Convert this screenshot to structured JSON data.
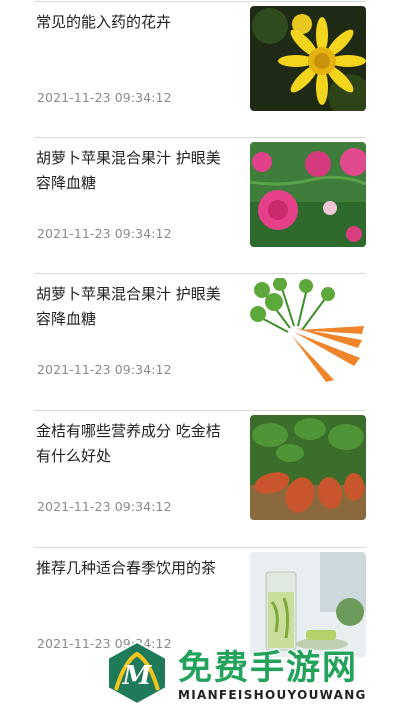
{
  "articles": [
    {
      "title": "常见的能入药的花卉",
      "time": "2021-11-23 09:34:12",
      "image": "yellow-chrysanthemum"
    },
    {
      "title": "胡萝卜苹果混合果汁 护眼美容降血糖",
      "time": "2021-11-23 09:34:12",
      "image": "pink-peonies"
    },
    {
      "title": "胡萝卜苹果混合果汁 护眼美容降血糖",
      "time": "2021-11-23 09:34:12",
      "image": "carrots"
    },
    {
      "title": "金桔有哪些营养成分 吃金桔有什么好处",
      "time": "2021-11-23 09:34:12",
      "image": "sweet-potatoes"
    },
    {
      "title": "推荐几种适合春季饮用的茶",
      "time": "2021-11-23 09:34:12",
      "image": "green-tea-glass"
    }
  ],
  "watermark": {
    "title": "免费手游网",
    "subtitle": "MIANFEISHOUYOUWANG",
    "logo_letter": "M"
  },
  "colors": {
    "text": "#222222",
    "time": "#8a8a8a",
    "divider": "#d9d9d9",
    "watermark_green": "#22a25b"
  }
}
